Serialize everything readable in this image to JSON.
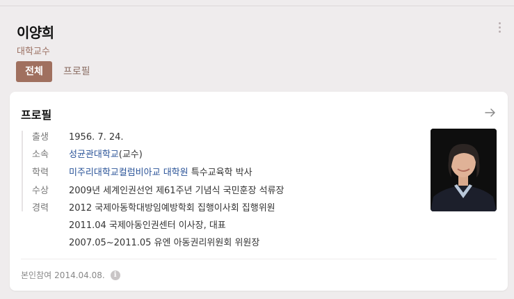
{
  "header": {
    "name": "이양희",
    "subtitle": "대학교수",
    "tabs": [
      {
        "label": "전체",
        "active": true
      },
      {
        "label": "프로필",
        "active": false
      }
    ]
  },
  "profile": {
    "title": "프로필",
    "birth": {
      "label": "출생",
      "value": "1956. 7. 24."
    },
    "affiliation": {
      "label": "소속",
      "link": "성균관대학교",
      "suffix": "(교수)"
    },
    "education": {
      "label": "학력",
      "link": "미주리대학교컬럼비아교 대학원",
      "suffix": " 특수교육학 박사"
    },
    "award": {
      "label": "수상",
      "value": "2009년 세계인권선언 제61주년 기념식 국민훈장 석류장"
    },
    "career": {
      "label": "경력",
      "items": [
        "2012 국제아동학대방임예방학회 집행이사회 집행위원",
        "2011.04 국제아동인권센터 이사장, 대표",
        "2007.05~2011.05 유엔 아동권리위원회 위원장"
      ]
    },
    "footer": {
      "label": "본인참여",
      "date": "2014.04.08.",
      "info_icon": "info-icon"
    }
  },
  "colors": {
    "accent": "#a0705f",
    "link": "#2a5398",
    "background": "#efeced"
  }
}
